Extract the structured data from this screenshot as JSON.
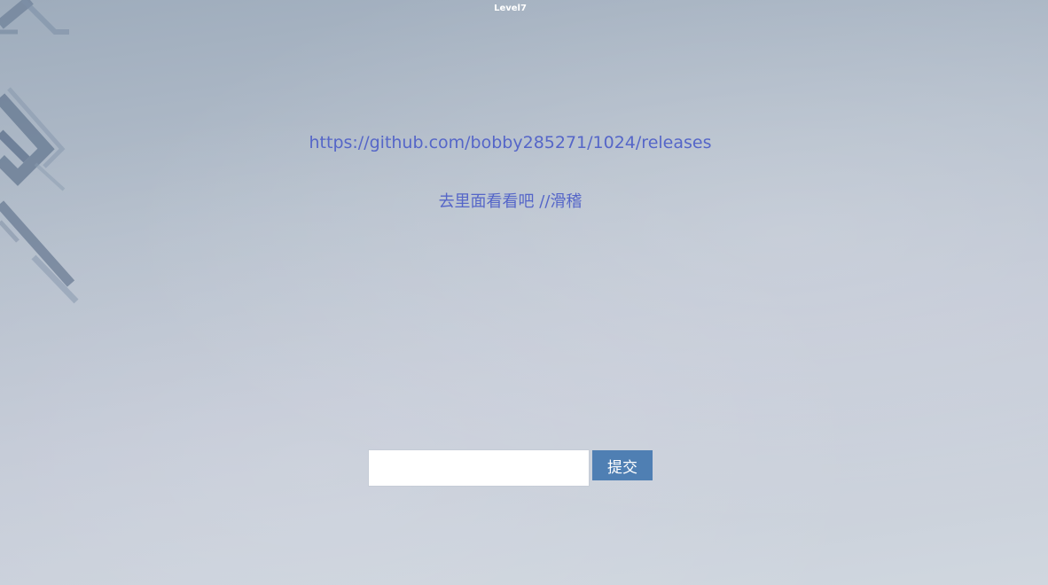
{
  "page": {
    "title": "Level7"
  },
  "content": {
    "link_text": "https://github.com/bobby285271/1024/releases",
    "hint_text": "去里面看看吧 //滑稽"
  },
  "form": {
    "input_value": "",
    "submit_label": "提交"
  },
  "colors": {
    "link": "#5566c8",
    "button": "#4f7fb3",
    "background_top": "#9eacbc",
    "background_bottom": "#d0d7df",
    "decoration": "#7a8ca3"
  }
}
